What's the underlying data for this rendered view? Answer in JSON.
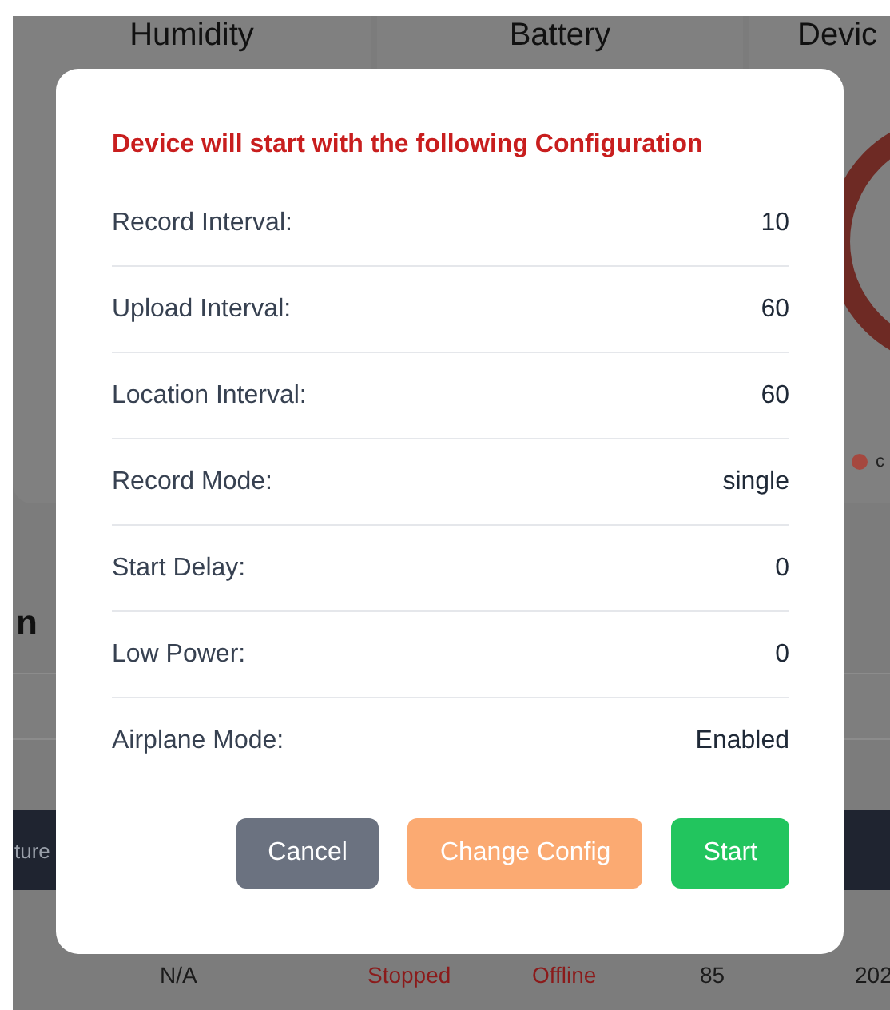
{
  "background": {
    "cards": [
      {
        "title": "Humidity"
      },
      {
        "title": "Battery"
      },
      {
        "title": "Devic"
      }
    ],
    "legend": {
      "label": "c",
      "color": "#a5483f"
    },
    "section_heading": "n",
    "table": {
      "header": [
        "ture"
      ],
      "rows": [
        {
          "cells": [
            {
              "text": "N/A",
              "kind": "plain"
            },
            {
              "text": "Stopped",
              "kind": "alert"
            },
            {
              "text": "Offline",
              "kind": "alert"
            },
            {
              "text": "85",
              "kind": "plain"
            },
            {
              "text": "202",
              "kind": "plain"
            }
          ]
        }
      ]
    }
  },
  "dialog": {
    "title": "Device will start with the following Configuration",
    "rows": [
      {
        "label": "Record Interval:",
        "value": "10"
      },
      {
        "label": "Upload Interval:",
        "value": "60"
      },
      {
        "label": "Location Interval:",
        "value": "60"
      },
      {
        "label": "Record Mode:",
        "value": "single"
      },
      {
        "label": "Start Delay:",
        "value": "0"
      },
      {
        "label": "Low Power:",
        "value": "0"
      },
      {
        "label": "Airplane Mode:",
        "value": "Enabled"
      }
    ],
    "buttons": [
      {
        "label": "Cancel",
        "kind": "secondary",
        "disabled": false
      },
      {
        "label": "Change Config",
        "kind": "warning",
        "disabled": true
      },
      {
        "label": "Start",
        "kind": "success",
        "disabled": false
      }
    ]
  }
}
